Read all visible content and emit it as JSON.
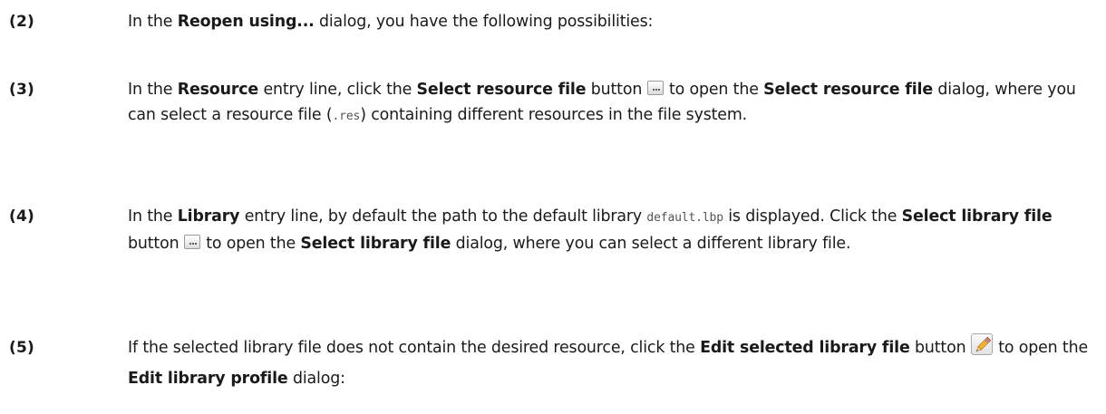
{
  "steps": [
    {
      "number": "(2)",
      "t1": "In the ",
      "b1": "Reopen using...",
      "t2": " dialog, you have the following possibilities:"
    },
    {
      "number": "(3)",
      "t1": "In the ",
      "b1": "Resource",
      "t2": " entry line, click the ",
      "b2": "Select resource file",
      "t3": " button ",
      "t4": " to open the ",
      "b3": "Select resource file",
      "t5": " dialog, where you can select a resource file (",
      "code1": ".res",
      "t6": ") containing different resources in the file system."
    },
    {
      "number": "(4)",
      "t1": "In the ",
      "b1": "Library",
      "t2": " entry line, by default the path to the default library ",
      "code1": "default.lbp",
      "t3": " is displayed. Click the ",
      "b2": "Select library file",
      "t4": " button ",
      "t5": " to open the ",
      "b3": "Select library file",
      "t6": " dialog, where you can select a different library file."
    },
    {
      "number": "(5)",
      "t1": "If the selected library file does not contain the desired resource, click the ",
      "b1": "Edit selected library file",
      "t2": " button ",
      "t3": " to open the ",
      "b2": "Edit library profile",
      "t4": " dialog:"
    }
  ],
  "icons": {
    "select_button": "ellipsis-button-icon",
    "edit_button": "pencil-icon"
  }
}
